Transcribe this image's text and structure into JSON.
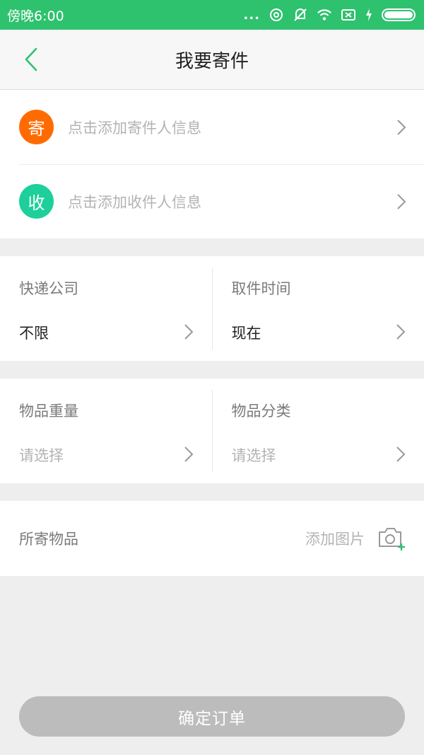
{
  "status_bar": {
    "time": "傍晚6:00",
    "dots": "...",
    "icons": [
      "sync-icon",
      "mute-icon",
      "wifi-icon",
      "sim-x-icon",
      "charging-icon",
      "battery-icon"
    ],
    "battery_level": 1.0
  },
  "header": {
    "title": "我要寄件",
    "back_icon": "chevron-left-icon"
  },
  "colors": {
    "accent": "#2ec26e",
    "sender_badge": "#ff6b00",
    "receiver_badge": "#1dcf9b",
    "button_disabled": "#bcbcbc"
  },
  "address": {
    "sender": {
      "badge": "寄",
      "label": "点击添加寄件人信息"
    },
    "receiver": {
      "badge": "收",
      "label": "点击添加收件人信息"
    }
  },
  "express": {
    "company": {
      "label": "快递公司",
      "value": "不限"
    },
    "pickup_time": {
      "label": "取件时间",
      "value": "现在"
    }
  },
  "item": {
    "weight": {
      "label": "物品重量",
      "value": "请选择"
    },
    "category": {
      "label": "物品分类",
      "value": "请选择"
    }
  },
  "goods": {
    "label": "所寄物品",
    "add_photo": "添加图片",
    "photo_icon": "camera-add-icon"
  },
  "footer": {
    "confirm": "确定订单"
  }
}
